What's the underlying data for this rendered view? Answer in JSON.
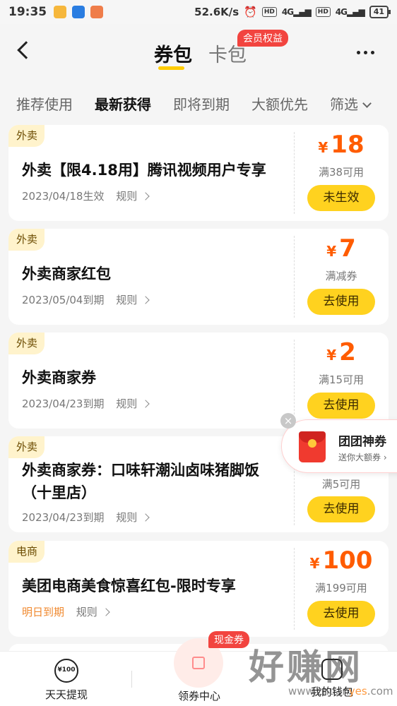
{
  "status_bar": {
    "time": "19:35",
    "net_speed": "52.6K/s",
    "hd1": "HD",
    "net1": "4G",
    "hd2": "HD",
    "net2": "4G",
    "battery": "41"
  },
  "header": {
    "tab_coupon": "券包",
    "tab_card": "卡包",
    "vip_badge": "会员权益"
  },
  "filters": [
    "推荐使用",
    "最新获得",
    "即将到期",
    "大额优先",
    "筛选"
  ],
  "coupons": [
    {
      "tag": "外卖",
      "title": "外卖【限4.18用】腾讯视频用户专享",
      "date": "2023/04/18生效",
      "rule": "规则",
      "currency": "¥",
      "amount": "18",
      "condition": "满38可用",
      "button": "未生效"
    },
    {
      "tag": "外卖",
      "title": "外卖商家红包",
      "date": "2023/05/04到期",
      "rule": "规则",
      "currency": "¥",
      "amount": "7",
      "condition": "满减券",
      "button": "去使用"
    },
    {
      "tag": "外卖",
      "title": "外卖商家券",
      "date": "2023/04/23到期",
      "rule": "规则",
      "currency": "¥",
      "amount": "2",
      "condition": "满15可用",
      "button": "去使用"
    },
    {
      "tag": "外卖",
      "title": "外卖商家券：口味轩潮汕卤味猪脚饭（十里店）",
      "date": "2023/04/23到期",
      "rule": "规则",
      "condition": "满5可用",
      "button": "去使用"
    },
    {
      "tag": "电商",
      "title": "美团电商美食惊喜红包-限时专享",
      "date": "明日到期",
      "rule": "规则",
      "currency": "¥",
      "amount": "100",
      "condition": "满199可用",
      "button": "去使用"
    }
  ],
  "float_promo": {
    "close": "×",
    "title": "团团神券",
    "subtitle": "送你大额券 ›"
  },
  "bottom_nav": {
    "withdraw_icon_text": "¥100",
    "withdraw": "天天提现",
    "center": "领券中心",
    "center_badge": "现金券",
    "mine": "我的钱包"
  },
  "watermark": {
    "text": "好赚网",
    "url_prefix": "www.zhuan",
    "url_highlight": "yes",
    "url_suffix": ".com"
  },
  "colors": {
    "accent_yellow": "#ffd21f",
    "price_orange": "#ff5c00",
    "badge_red": "#f2443f"
  }
}
